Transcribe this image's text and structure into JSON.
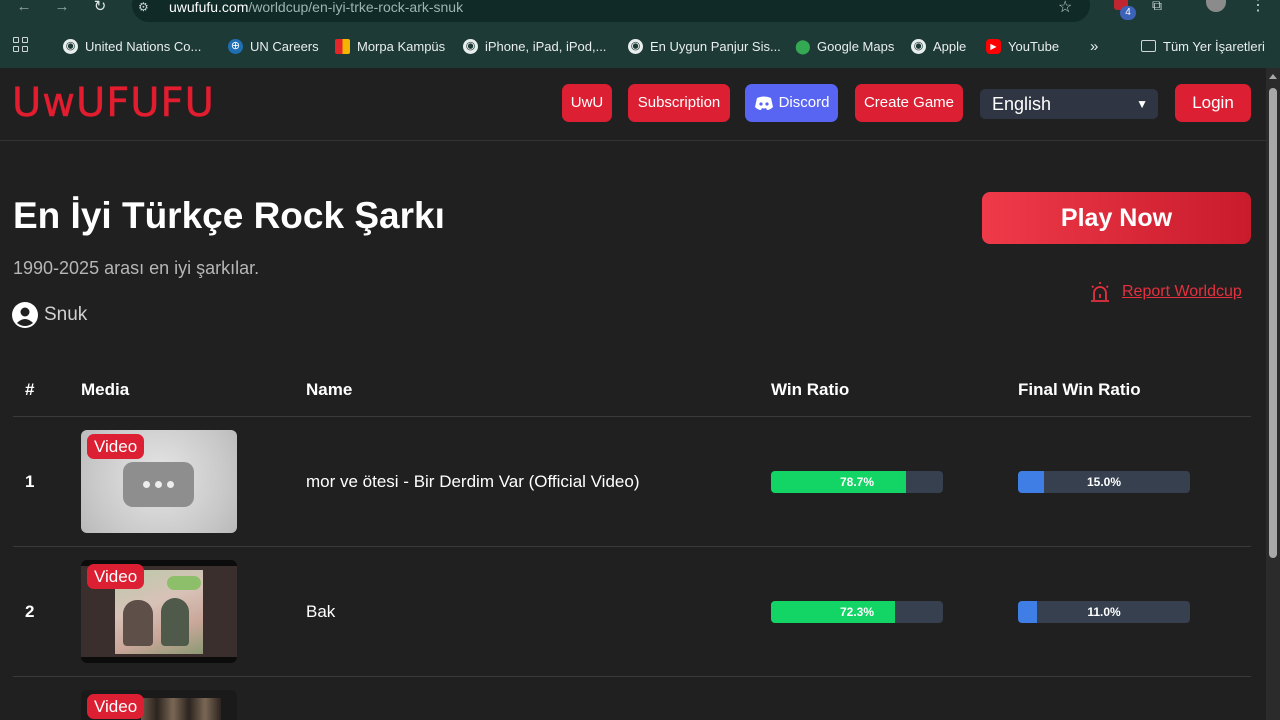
{
  "browser": {
    "url_host": "uwufufu.com",
    "url_path": "/worldcup/en-iyi-trke-rock-ark-snuk",
    "extension_badge": "4",
    "bookmarks": [
      {
        "label": "United Nations Co...",
        "icon": "globe-icon"
      },
      {
        "label": "UN Careers",
        "icon": "un-icon"
      },
      {
        "label": "Morpa Kampüs",
        "icon": "morpa-icon"
      },
      {
        "label": "iPhone, iPad, iPod,...",
        "icon": "globe-icon"
      },
      {
        "label": "En Uygun Panjur Sis...",
        "icon": "globe-icon"
      },
      {
        "label": "Google Maps",
        "icon": "maps-icon"
      },
      {
        "label": "Apple",
        "icon": "globe-icon"
      },
      {
        "label": "YouTube",
        "icon": "youtube-icon"
      }
    ],
    "overflow_label": "»",
    "all_bookmarks_label": "Tüm Yer İşaretleri"
  },
  "header": {
    "logo": "UwUFUFU",
    "buttons": {
      "uwu": "UwU",
      "subscription": "Subscription",
      "discord": "Discord",
      "create_game": "Create Game",
      "login": "Login"
    },
    "language": "English"
  },
  "main": {
    "title": "En İyi Türkçe Rock Şarkı",
    "subtitle": "1990-2025 arası en iyi şarkılar.",
    "author": "Snuk",
    "play_label": "Play Now",
    "report_label": "Report Worldcup"
  },
  "table": {
    "headers": [
      "#",
      "Media",
      "Name",
      "Win Ratio",
      "Final Win Ratio"
    ],
    "rows": [
      {
        "rank": "1",
        "media_badge": "Video",
        "name": "mor ve ötesi - Bir Derdim Var (Official Video)",
        "win_ratio": "78.7%",
        "win_value": 78.7,
        "final_ratio": "15.0%",
        "final_value": 15.0
      },
      {
        "rank": "2",
        "media_badge": "Video",
        "name": "Bak",
        "win_ratio": "72.3%",
        "win_value": 72.3,
        "final_ratio": "11.0%",
        "final_value": 11.0
      },
      {
        "rank": "",
        "media_badge": "Video",
        "name": "",
        "win_ratio": "",
        "final_ratio": ""
      }
    ]
  },
  "colors": {
    "brand_red": "#dc1f32",
    "win_green": "#12d565",
    "final_blue": "#3f7fe5",
    "discord": "#5865f2"
  }
}
